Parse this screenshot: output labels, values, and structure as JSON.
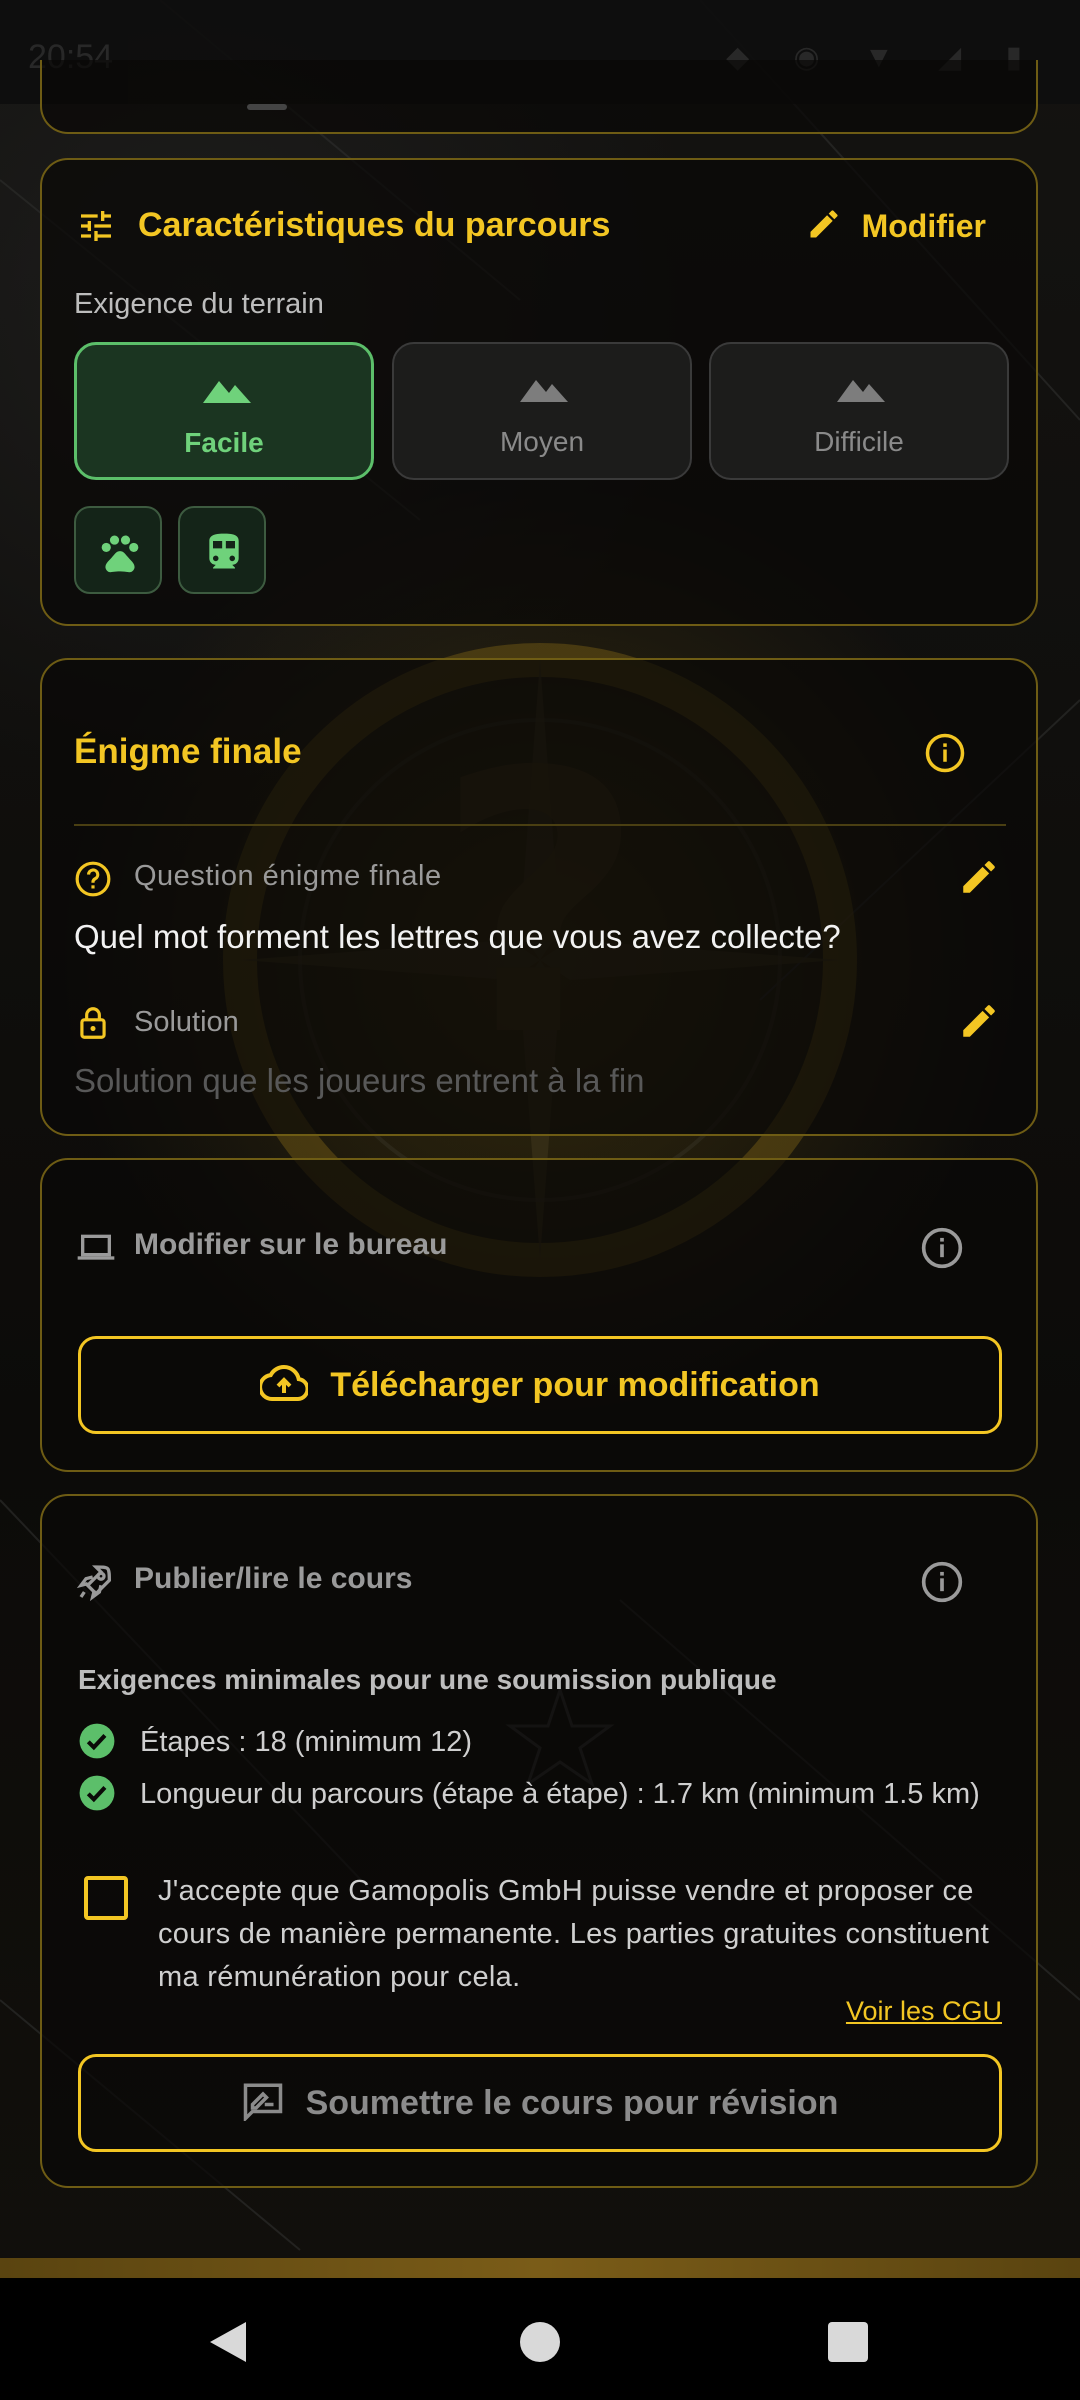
{
  "status_bar": {
    "time": "20:54"
  },
  "course_features": {
    "title": "Caractéristiques du parcours",
    "edit_label": "Modifier",
    "terrain_label": "Exigence du terrain",
    "terrain_options": [
      "Facile",
      "Moyen",
      "Difficile"
    ],
    "terrain_selected": "Facile",
    "feature_chips": [
      "paw-icon",
      "train-icon"
    ]
  },
  "final_riddle": {
    "title": "Énigme finale",
    "question_label": "Question énigme finale",
    "question_value": "Quel mot forment les lettres que vous avez collecte?",
    "solution_label": "Solution",
    "solution_placeholder": "Solution que les joueurs entrent à la fin"
  },
  "desktop_edit": {
    "title": "Modifier sur le bureau",
    "upload_button": "Télécharger pour modification"
  },
  "publish": {
    "title": "Publier/lire le cours",
    "requirements_title": "Exigences minimales pour une soumission publique",
    "requirements": [
      "Étapes : 18 (minimum 12)",
      "Longueur du parcours (étape à étape) : 1.7 km (minimum 1.5 km)"
    ],
    "accept_text": "J'accepte que Gamopolis GmbH puisse vendre et proposer ce cours de manière permanente. Les parties gratuites constituent ma rémunération pour cela.",
    "accept_checked": false,
    "terms_link": "Voir les CGU",
    "submit_button": "Soumettre le cours pour révision"
  },
  "colors": {
    "accent": "#f3c623",
    "success": "#5cbf6a",
    "border": "#6e5c14"
  }
}
